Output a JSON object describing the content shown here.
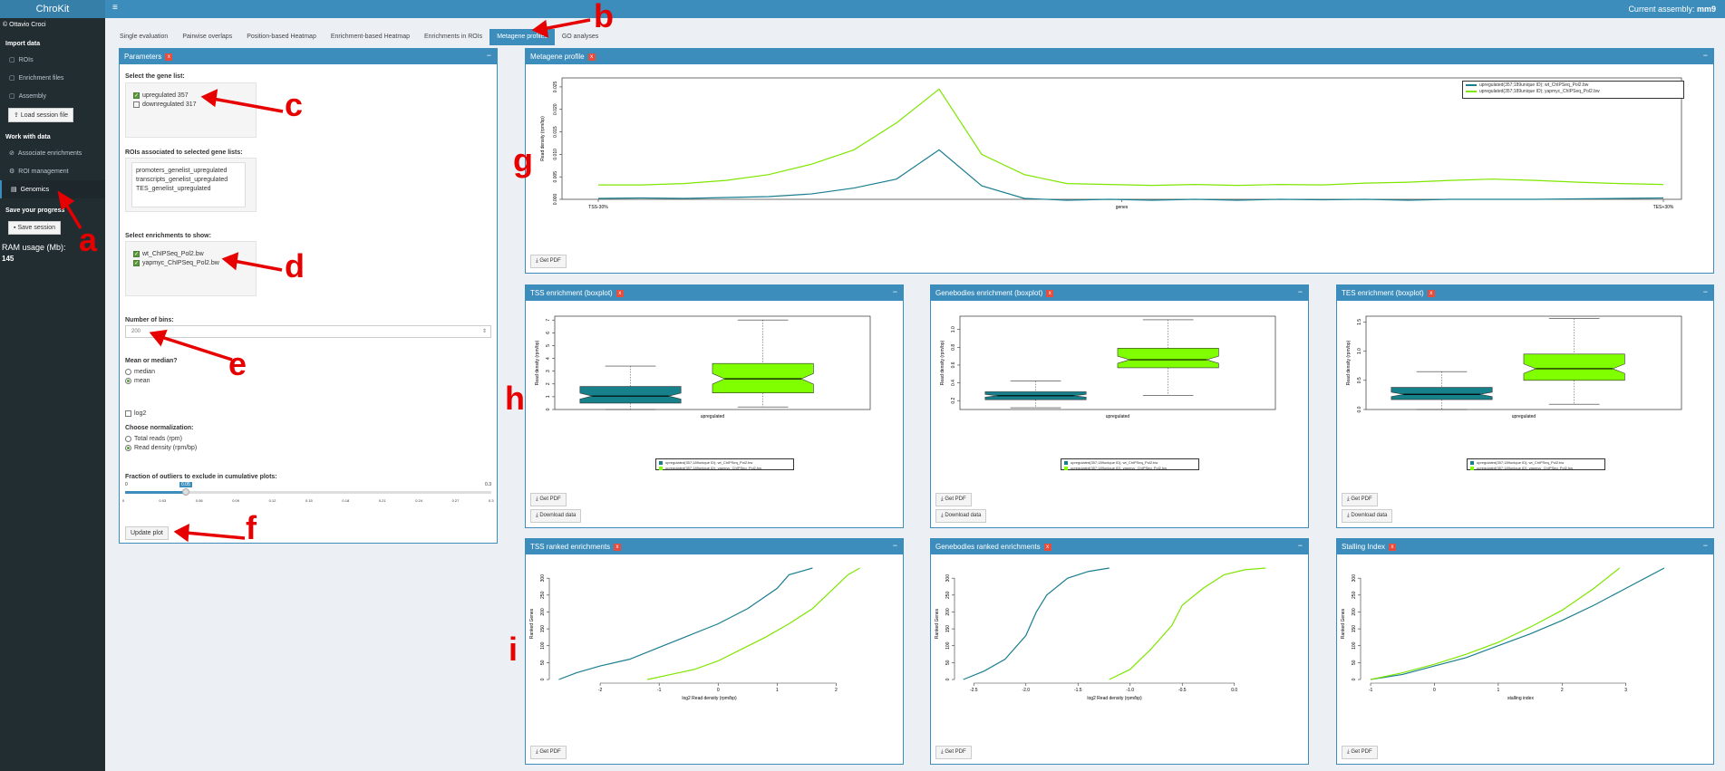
{
  "app": {
    "title": "ChroKit",
    "author": "© Ottavio Croci",
    "assembly_label": "Current assembly:",
    "assembly_value": "mm9"
  },
  "sidebar": {
    "import_header": "Import data",
    "items_import": [
      {
        "label": "ROIs",
        "icon": "file-icon"
      },
      {
        "label": "Enrichment files",
        "icon": "file-icon"
      },
      {
        "label": "Assembly",
        "icon": "file-icon"
      }
    ],
    "load_session": "Load session file",
    "work_header": "Work with data",
    "items_work": [
      {
        "label": "Associate enrichments",
        "icon": "paperclip-icon"
      },
      {
        "label": "ROI management",
        "icon": "gear-icon"
      },
      {
        "label": "Genomics",
        "icon": "chart-icon"
      }
    ],
    "save_header": "Save your progress",
    "save_session": "Save session",
    "ram_label": "RAM usage (Mb):",
    "ram_value": "145"
  },
  "tabs": [
    "Single evaluation",
    "Pairwise overlaps",
    "Position-based Heatmap",
    "Enrichment-based Heatmap",
    "Enrichments in ROIs",
    "Metagene profiles",
    "GO analyses"
  ],
  "active_tab": "Metagene profiles",
  "params": {
    "title": "Parameters",
    "gene_list_label": "Select the gene list:",
    "gene_lists": [
      {
        "label": "upregulated 357",
        "checked": true
      },
      {
        "label": "downregulated 317",
        "checked": false
      }
    ],
    "rois_label": "ROIs associated to selected gene lists:",
    "rois": [
      "promoters_genelist_upregulated",
      "transcripts_genelist_upregulated",
      "TES_genelist_upregulated"
    ],
    "enrich_label": "Select enrichments to show:",
    "enrichments": [
      {
        "label": "wt_ChIPSeq_Pol2.bw",
        "checked": true
      },
      {
        "label": "yapmyc_ChIPSeq_Pol2.bw",
        "checked": true
      }
    ],
    "bins_label": "Number of bins:",
    "bins_value": "200",
    "mean_label": "Mean or median?",
    "mean_options": [
      {
        "label": "median",
        "selected": false
      },
      {
        "label": "mean",
        "selected": true
      }
    ],
    "log2_label": "log2",
    "norm_label": "Choose normalization:",
    "norm_options": [
      {
        "label": "Total reads (rpm)",
        "selected": false
      },
      {
        "label": "Read density (rpm/bp)",
        "selected": true
      }
    ],
    "outliers_label": "Fraction of outliers to exclude in cumulative plots:",
    "slider_min": "0",
    "slider_max": "0.3",
    "slider_value": "0.05",
    "slider_ticks": [
      "0",
      "0.03",
      "0.06",
      "0.09",
      "0.12",
      "0.15",
      "0.18",
      "0.21",
      "0.24",
      "0.27",
      "0.3"
    ],
    "update_btn": "Update plot"
  },
  "panels": {
    "metagene_title": "Metagene profile",
    "tss_box_title": "TSS enrichment (boxplot)",
    "gb_box_title": "Genebodies enrichment (boxplot)",
    "tes_box_title": "TES enrichment (boxplot)",
    "tss_rank_title": "TSS ranked enrichments",
    "gb_rank_title": "Genebodies ranked enrichments",
    "stall_title": "Stalling Index",
    "get_pdf": "Get PDF",
    "download_data": "Download data",
    "minimize": "−",
    "close": "x"
  },
  "legend": [
    "upregulated(357;189unique ID); wt_ChIPSeq_Pol2.bw",
    "upregulated(357;189unique ID); yapmyc_ChIPSeq_Pol2.bw"
  ],
  "colors": {
    "wt": "#1a7e8f",
    "yap": "#7fe600",
    "box_wt": "#16808b",
    "box_yap": "#80ff00",
    "accent": "#3c8dbc",
    "annotation": "#e60000"
  },
  "annotations": [
    "a",
    "b",
    "c",
    "d",
    "e",
    "f",
    "g",
    "h",
    "i"
  ],
  "chart_data": [
    {
      "type": "line",
      "name": "Metagene profile",
      "xlabel": "genes",
      "ylabel": "Read density (rpm/bp)",
      "x_ticks": [
        "TSS-30%",
        "genes",
        "TES+30%"
      ],
      "y_ticks": [
        "0.000",
        "0.005",
        "0.010",
        "0.015",
        "0.020",
        "0.025"
      ],
      "ylim": [
        0,
        0.027
      ],
      "series": [
        {
          "name": "upregulated(357;189unique ID); wt_ChIPSeq_Pol2.bw",
          "values": [
            0.0002,
            0.0003,
            0.0002,
            0.0004,
            0.0006,
            0.0012,
            0.0025,
            0.0045,
            0.011,
            0.003,
            0.0002,
            -0.0002,
            0,
            -0.0002,
            0,
            -0.0002,
            0,
            -0.0001,
            0,
            -0.0002,
            0,
            0,
            0,
            0.0001,
            0.0002,
            0.0003
          ]
        },
        {
          "name": "upregulated(357;189unique ID); yapmyc_ChIPSeq_Pol2.bw",
          "values": [
            0.0032,
            0.0032,
            0.0035,
            0.0042,
            0.0055,
            0.0078,
            0.011,
            0.017,
            0.0245,
            0.01,
            0.0055,
            0.0035,
            0.0033,
            0.0031,
            0.0033,
            0.0031,
            0.0033,
            0.0032,
            0.0036,
            0.0038,
            0.0042,
            0.0045,
            0.0042,
            0.0038,
            0.0035,
            0.0033
          ]
        }
      ]
    },
    {
      "type": "box",
      "name": "TSS enrichment (boxplot)",
      "xlabel": "upregulated",
      "ylabel": "Read density (rpm/bp)",
      "ylim": [
        0,
        7.3
      ],
      "y_ticks": [
        "0",
        "1",
        "2",
        "3",
        "4",
        "5",
        "6",
        "7"
      ],
      "boxes": [
        {
          "series": "wt",
          "min": 0,
          "q1": 0.5,
          "median": 1.05,
          "q3": 1.8,
          "max": 3.4
        },
        {
          "series": "yapmyc",
          "min": 0.2,
          "q1": 1.3,
          "median": 2.4,
          "q3": 3.6,
          "max": 7.0
        }
      ]
    },
    {
      "type": "box",
      "name": "Genebodies enrichment (boxplot)",
      "xlabel": "upregulated",
      "ylabel": "Read density (rpm/bp)",
      "ylim": [
        0.1,
        1.15
      ],
      "y_ticks": [
        "0.2",
        "0.4",
        "0.6",
        "0.8",
        "1.0"
      ],
      "boxes": [
        {
          "series": "wt",
          "min": 0.12,
          "q1": 0.21,
          "median": 0.255,
          "q3": 0.3,
          "max": 0.42
        },
        {
          "series": "yapmyc",
          "min": 0.26,
          "q1": 0.57,
          "median": 0.66,
          "q3": 0.79,
          "max": 1.11
        }
      ]
    },
    {
      "type": "box",
      "name": "TES enrichment (boxplot)",
      "xlabel": "upregulated",
      "ylabel": "Read density (rpm/bp)",
      "ylim": [
        0,
        1.6
      ],
      "y_ticks": [
        "0.0",
        "0.5",
        "1.0",
        "1.5"
      ],
      "boxes": [
        {
          "series": "wt",
          "min": 0,
          "q1": 0.17,
          "median": 0.26,
          "q3": 0.38,
          "max": 0.65
        },
        {
          "series": "yapmyc",
          "min": 0.09,
          "q1": 0.5,
          "median": 0.7,
          "q3": 0.95,
          "max": 1.56
        }
      ]
    },
    {
      "type": "line",
      "name": "TSS ranked enrichments",
      "xlabel": "log2 Read density (rpm/bp)",
      "ylabel": "Ranked Genes",
      "xlim": [
        -2.8,
        2.5
      ],
      "ylim": [
        0,
        330
      ],
      "x_ticks": [
        -2,
        -1,
        0,
        1,
        2
      ],
      "y_ticks": [
        0,
        50,
        100,
        150,
        200,
        250,
        300
      ],
      "series": [
        {
          "name": "wt",
          "x": [
            -2.7,
            -2.4,
            -2,
            -1.5,
            -1,
            -0.5,
            0,
            0.5,
            1,
            1.2,
            1.6
          ],
          "y": [
            0,
            20,
            40,
            60,
            95,
            130,
            165,
            210,
            270,
            310,
            330
          ]
        },
        {
          "name": "yapmyc",
          "x": [
            -1.2,
            -0.8,
            -0.4,
            0,
            0.4,
            0.8,
            1.2,
            1.6,
            1.9,
            2.2,
            2.4
          ],
          "y": [
            0,
            15,
            30,
            55,
            90,
            125,
            165,
            210,
            260,
            310,
            330
          ]
        }
      ]
    },
    {
      "type": "line",
      "name": "Genebodies ranked enrichments",
      "xlabel": "log2 Read density (rpm/bp)",
      "ylabel": "Ranked Genes",
      "xlim": [
        -2.65,
        0.35
      ],
      "ylim": [
        0,
        330
      ],
      "x_ticks": [
        -2.5,
        -2.0,
        -1.5,
        -1.0,
        -0.5,
        0.0
      ],
      "y_ticks": [
        0,
        50,
        100,
        150,
        200,
        250,
        300
      ],
      "series": [
        {
          "name": "wt",
          "x": [
            -2.6,
            -2.4,
            -2.2,
            -2.0,
            -1.9,
            -1.8,
            -1.6,
            -1.4,
            -1.2
          ],
          "y": [
            0,
            25,
            60,
            130,
            200,
            250,
            300,
            320,
            330
          ]
        },
        {
          "name": "yapmyc",
          "x": [
            -1.2,
            -1.0,
            -0.8,
            -0.6,
            -0.5,
            -0.3,
            -0.1,
            0.1,
            0.3
          ],
          "y": [
            0,
            30,
            90,
            160,
            220,
            270,
            310,
            325,
            330
          ]
        }
      ]
    },
    {
      "type": "line",
      "name": "Stalling Index",
      "xlabel": "stalling index",
      "ylabel": "Ranked Genes",
      "xlim": [
        -1.1,
        3.8
      ],
      "ylim": [
        0,
        330
      ],
      "x_ticks": [
        -1,
        0,
        1,
        2,
        3
      ],
      "y_ticks": [
        0,
        50,
        100,
        150,
        200,
        250,
        300
      ],
      "series": [
        {
          "name": "wt",
          "x": [
            -1,
            -0.5,
            0,
            0.5,
            1,
            1.5,
            2,
            2.5,
            3,
            3.6
          ],
          "y": [
            0,
            15,
            40,
            65,
            100,
            135,
            175,
            220,
            270,
            330
          ]
        },
        {
          "name": "yapmyc",
          "x": [
            -1,
            -0.5,
            0,
            0.5,
            1,
            1.5,
            2,
            2.5,
            2.9
          ],
          "y": [
            0,
            20,
            45,
            75,
            110,
            155,
            205,
            270,
            330
          ]
        }
      ]
    }
  ]
}
